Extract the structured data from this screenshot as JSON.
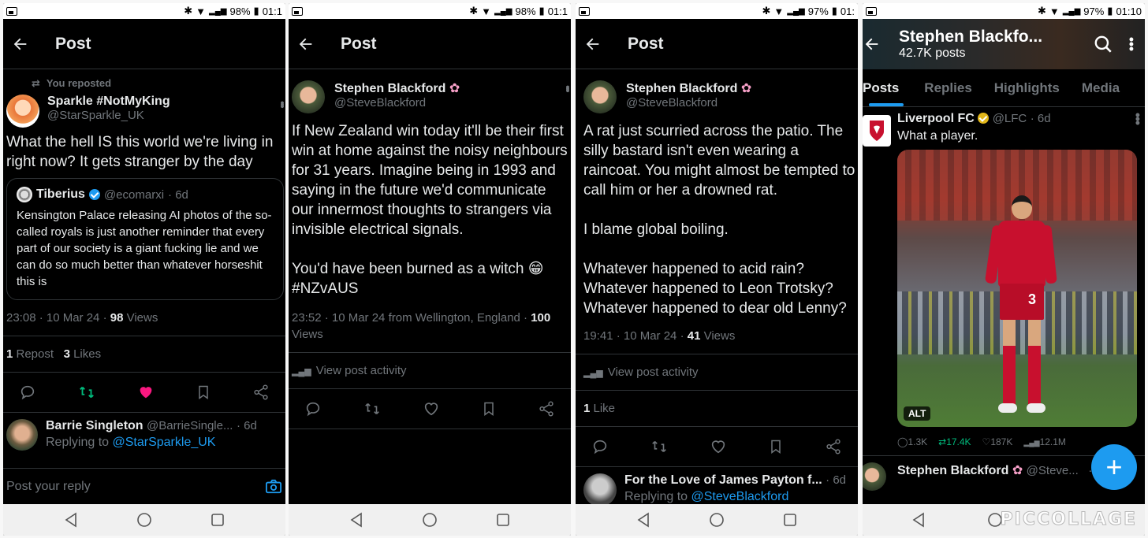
{
  "panel1": {
    "status": {
      "battery": "98%",
      "time": "01:1"
    },
    "title": "Post",
    "repost_note": "You reposted",
    "author": {
      "name": "Sparkle #NotMyKing",
      "handle": "@StarSparkle_UK"
    },
    "body": "What the hell IS this world we're living in right now? It gets stranger by the day",
    "quote": {
      "name": "Tiberius",
      "handle": "@ecomarxi",
      "age": "· 6d",
      "text": "Kensington Palace releasing AI photos of the so-called royals is just another reminder that every part of our society is a giant fucking lie and we can do so much better than whatever horseshit this is"
    },
    "meta_time": "23:08 · 10 Mar 24 · ",
    "views_count": "98",
    "views_label": " Views",
    "reposts_count": "1",
    "reposts_label": " Repost",
    "likes_count": "3",
    "likes_label": " Likes",
    "reply": {
      "name": "Barrie Singleton",
      "handle": "@BarrieSingle...",
      "age": "· 6d",
      "replying_prefix": "Replying to ",
      "replying_to": "@StarSparkle_UK"
    },
    "reply_placeholder": "Post your reply"
  },
  "panel2": {
    "status": {
      "battery": "98%",
      "time": "01:1"
    },
    "title": "Post",
    "author": {
      "name": "Stephen Blackford",
      "handle": "@SteveBlackford"
    },
    "body": "If New Zealand win today it'll be their first win at home against the noisy neighbours for 31 years. Imagine being in 1993 and saying in the future we'd communicate our innermost thoughts to strangers via invisible electrical signals.",
    "body2": "You'd have been burned as a witch 😁",
    "hashtag": "#NZvAUS",
    "meta": "23:52 · 10 Mar 24 from Wellington, England · ",
    "views_count": "100",
    "views_label": "Views",
    "activity": "View post activity"
  },
  "panel3": {
    "status": {
      "battery": "97%",
      "time": "01:"
    },
    "title": "Post",
    "author": {
      "name": "Stephen Blackford",
      "handle": "@SteveBlackford"
    },
    "para1": "A rat just scurried across the patio. The silly bastard isn't even wearing a raincoat. You might almost be tempted to call him or her a drowned rat.",
    "para2": "I blame global boiling.",
    "para3": "Whatever happened to acid rain? Whatever happened to Leon Trotsky? Whatever happened to dear old Lenny?",
    "meta_time": "19:41 · 10 Mar 24 · ",
    "views_count": "41",
    "views_label": " Views",
    "activity": "View post activity",
    "likes_count": "1",
    "likes_label": " Like",
    "reply": {
      "name": "For the Love of James Payton f...",
      "age": "· 6d",
      "replying_prefix": "Replying to ",
      "replying_to": "@SteveBlackford"
    }
  },
  "panel4": {
    "status": {
      "battery": "97%",
      "time": "01:10"
    },
    "profile_name": "Stephen Blackfo...",
    "posts_count": "42.7K posts",
    "tabs": [
      "Posts",
      "Replies",
      "Highlights",
      "Media"
    ],
    "post": {
      "name": "Liverpool FC",
      "handle": "@LFC",
      "age": "· 6d",
      "text": "What a player.",
      "alt": "ALT",
      "player_number": "3",
      "stats": {
        "replies": "1.3K",
        "reposts": "17.4K",
        "likes": "187K",
        "views": "12.1M"
      }
    },
    "next": {
      "name": "Stephen Blackford",
      "handle": "@Steve...",
      "age": "· 6d"
    },
    "watermark": "PICCOLLAGE"
  }
}
